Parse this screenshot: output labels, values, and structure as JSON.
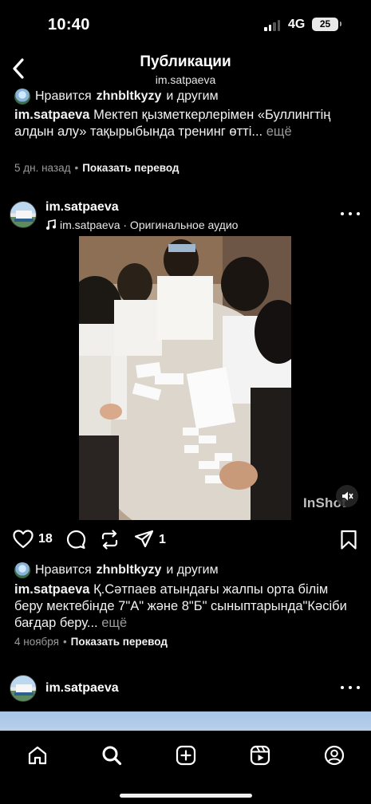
{
  "status_bar": {
    "time": "10:40",
    "network": "4G",
    "battery": "25"
  },
  "header": {
    "title": "Публикации",
    "subtitle": "im.satpaeva"
  },
  "previous_post": {
    "likes_prefix": "Нравится",
    "likes_user": "zhnbltkyzy",
    "likes_suffix": "и другим",
    "caption_user": "im.satpaeva",
    "caption_text": " Мектеп қызметкерлерімен «Буллингтің алдын алу» тақырыбында тренинг өтті...",
    "caption_more": " ещё",
    "time_ago": "5 дн. назад",
    "dot": "•",
    "translate": "Показать перевод"
  },
  "post": {
    "username": "im.satpaeva",
    "audio": "im.satpaeva · Оригинальное аудио",
    "watermark": "InShot",
    "like_count": "18",
    "share_count": "1",
    "likes_prefix": "Нравится",
    "likes_user": "zhnbltkyzy",
    "likes_suffix": "и другим",
    "caption_user": "im.satpaeva",
    "caption_text": " Қ.Сәтпаев атындағы жалпы орта білім беру мектебінде 7\"А\" және 8\"Б\" сыныптарында\"Кәсіби бағдар беру...",
    "caption_more": " ещё",
    "date": "4 ноября",
    "dot": "•",
    "translate": "Показать перевод"
  },
  "next_post": {
    "username": "im.satpaeva"
  },
  "icons": {
    "back": "chevron-left-icon",
    "like": "heart-icon",
    "comment": "comment-icon",
    "repost": "repost-icon",
    "share": "send-icon",
    "save": "bookmark-icon",
    "music": "music-note-icon",
    "mute": "speaker-muted-icon",
    "more": "more-horizontal-icon"
  },
  "nav": [
    "home-icon",
    "search-icon",
    "create-icon",
    "reels-icon",
    "profile-icon"
  ]
}
